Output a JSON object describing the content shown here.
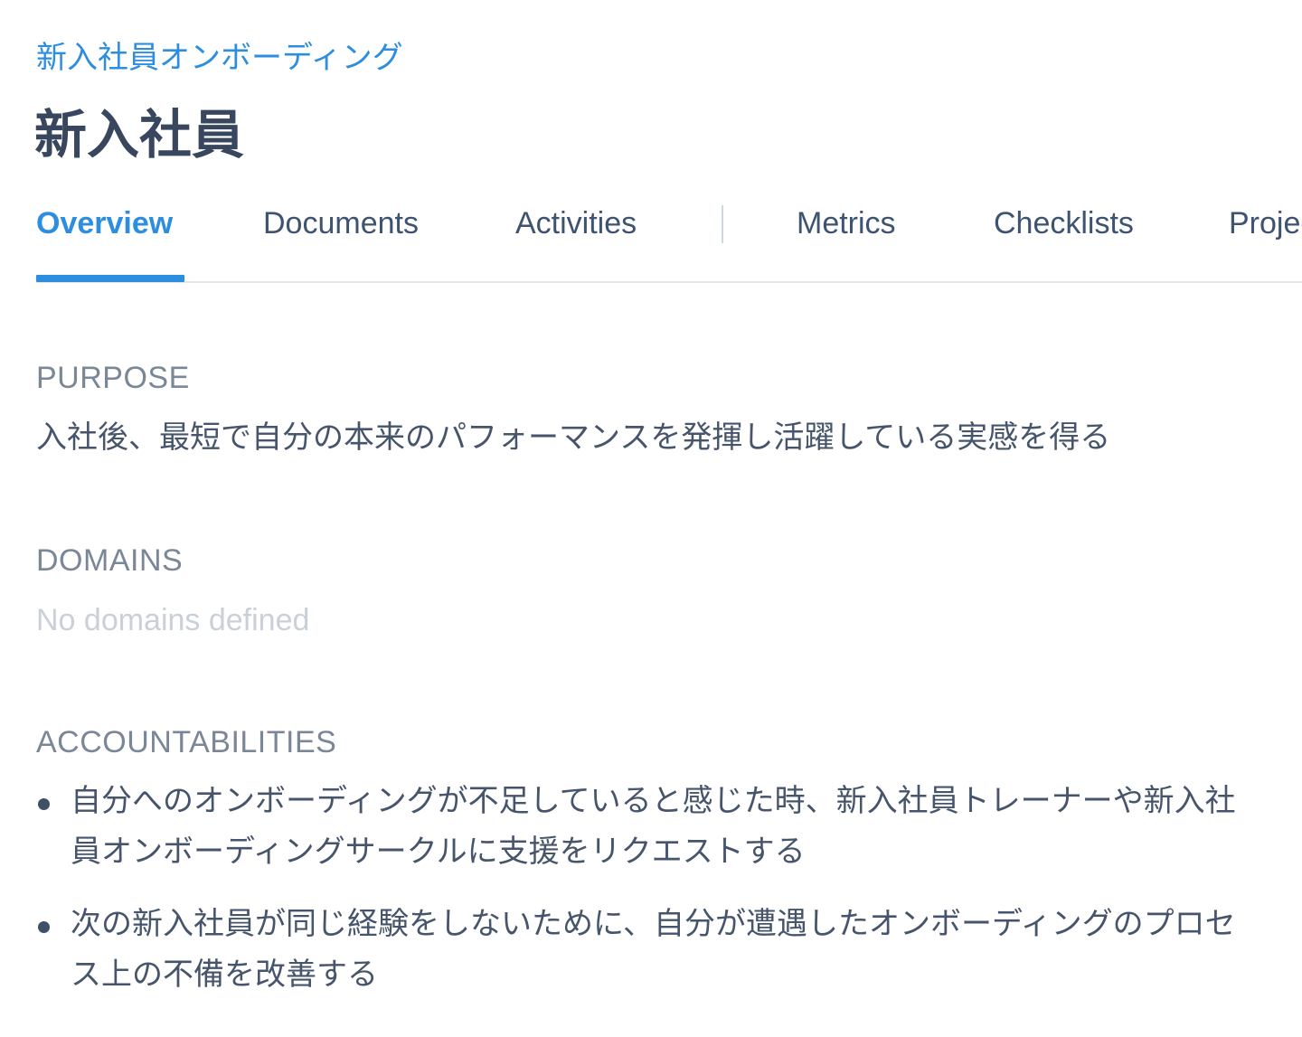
{
  "breadcrumb": {
    "label": "新入社員オンボーディング"
  },
  "page": {
    "title": "新入社員"
  },
  "tabs": [
    {
      "label": "Overview",
      "active": true
    },
    {
      "label": "Documents",
      "active": false
    },
    {
      "label": "Activities",
      "active": false
    },
    {
      "label": "Metrics",
      "active": false
    },
    {
      "label": "Checklists",
      "active": false
    },
    {
      "label": "Projects",
      "active": false
    }
  ],
  "purpose": {
    "label": "PURPOSE",
    "text": "入社後、最短で自分の本来のパフォーマンスを発揮し活躍している実感を得る"
  },
  "domains": {
    "label": "DOMAINS",
    "empty_text": "No domains defined"
  },
  "accountabilities": {
    "label": "ACCOUNTABILITIES",
    "items": [
      "自分へのオンボーディングが不足していると感じた時、新入社員トレーナーや新入社員オンボーディングサークルに支援をリクエストする",
      "次の新入社員が同じ経験をしないために、自分が遭遇したオンボーディングのプロセス上の不備を改善する"
    ]
  },
  "colors": {
    "accent": "#2d8ee0",
    "title": "#38475e",
    "label": "#7a8797",
    "empty": "#c9d0d8"
  }
}
